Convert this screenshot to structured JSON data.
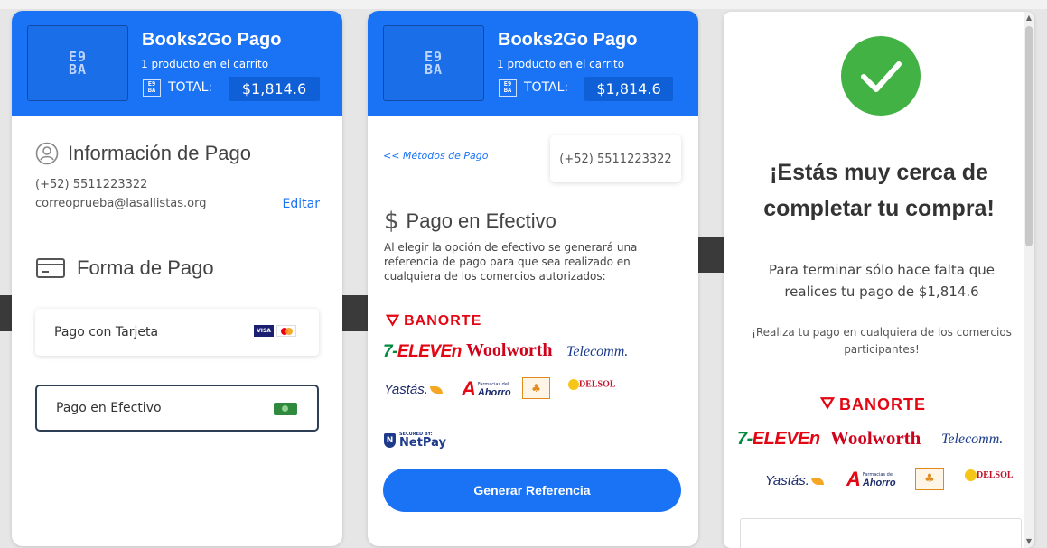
{
  "brand": {
    "logo_text_top": "E9",
    "logo_text_bottom": "BA",
    "store_name": "Books2Go Pago",
    "cart_summary": "1 producto en el carrito",
    "total_label": "TOTAL:",
    "total_value": "$1,814.6",
    "accent_color": "#1a73f5"
  },
  "panel1": {
    "info_title": "Información de Pago",
    "phone": "(+52) 5511223322",
    "email": "correoprueba@lasallistas.org",
    "edit_link": "Editar",
    "payment_title": "Forma de Pago",
    "card_option": "Pago con Tarjeta",
    "cash_option": "Pago en Efectivo",
    "visa_label": "VISA"
  },
  "panel2": {
    "back_link": "<< Métodos de Pago",
    "phone": "(+52) 5511223322",
    "cash_title": "Pago en Efectivo",
    "description": "Al elegir la opción de efectivo se generará una referencia de pago para que sea realizado en cualquiera de los comercios autorizados:",
    "netpay_secured": "SECURED BY:",
    "netpay_brand": "NetPay",
    "generate_button": "Generar Referencia"
  },
  "stores": {
    "banorte": "BANORTE",
    "seven_eleven_prefix": "7-",
    "seven_eleven_word": "ELEVEn",
    "woolworth": "Woolworth",
    "telecomm": "Telecomm.",
    "yastas": "Yastás.",
    "ahorro_small": "Farmacias del",
    "ahorro": "Ahorro",
    "delsol": "DELSOL"
  },
  "panel3": {
    "title": "¡Estás muy cerca de completar tu compra!",
    "text": "Para terminar sólo hace falta que realices tu pago de $1,814.6",
    "small": "¡Realiza tu pago en cualquiera de los comercios participantes!"
  }
}
